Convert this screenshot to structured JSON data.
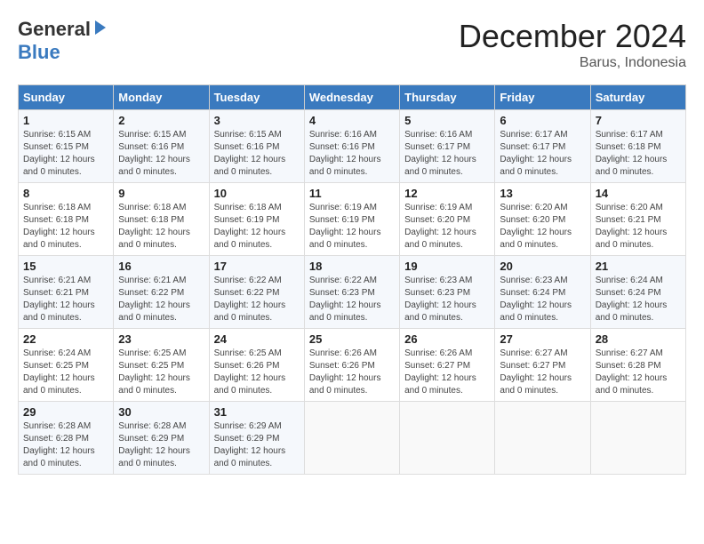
{
  "logo": {
    "general": "General",
    "blue": "Blue"
  },
  "title": {
    "month_year": "December 2024",
    "location": "Barus, Indonesia"
  },
  "days_of_week": [
    "Sunday",
    "Monday",
    "Tuesday",
    "Wednesday",
    "Thursday",
    "Friday",
    "Saturday"
  ],
  "weeks": [
    [
      {
        "day": "1",
        "sunrise": "6:15 AM",
        "sunset": "6:15 PM",
        "daylight": "12 hours and 0 minutes."
      },
      {
        "day": "2",
        "sunrise": "6:15 AM",
        "sunset": "6:16 PM",
        "daylight": "12 hours and 0 minutes."
      },
      {
        "day": "3",
        "sunrise": "6:15 AM",
        "sunset": "6:16 PM",
        "daylight": "12 hours and 0 minutes."
      },
      {
        "day": "4",
        "sunrise": "6:16 AM",
        "sunset": "6:16 PM",
        "daylight": "12 hours and 0 minutes."
      },
      {
        "day": "5",
        "sunrise": "6:16 AM",
        "sunset": "6:17 PM",
        "daylight": "12 hours and 0 minutes."
      },
      {
        "day": "6",
        "sunrise": "6:17 AM",
        "sunset": "6:17 PM",
        "daylight": "12 hours and 0 minutes."
      },
      {
        "day": "7",
        "sunrise": "6:17 AM",
        "sunset": "6:18 PM",
        "daylight": "12 hours and 0 minutes."
      }
    ],
    [
      {
        "day": "8",
        "sunrise": "6:18 AM",
        "sunset": "6:18 PM",
        "daylight": "12 hours and 0 minutes."
      },
      {
        "day": "9",
        "sunrise": "6:18 AM",
        "sunset": "6:18 PM",
        "daylight": "12 hours and 0 minutes."
      },
      {
        "day": "10",
        "sunrise": "6:18 AM",
        "sunset": "6:19 PM",
        "daylight": "12 hours and 0 minutes."
      },
      {
        "day": "11",
        "sunrise": "6:19 AM",
        "sunset": "6:19 PM",
        "daylight": "12 hours and 0 minutes."
      },
      {
        "day": "12",
        "sunrise": "6:19 AM",
        "sunset": "6:20 PM",
        "daylight": "12 hours and 0 minutes."
      },
      {
        "day": "13",
        "sunrise": "6:20 AM",
        "sunset": "6:20 PM",
        "daylight": "12 hours and 0 minutes."
      },
      {
        "day": "14",
        "sunrise": "6:20 AM",
        "sunset": "6:21 PM",
        "daylight": "12 hours and 0 minutes."
      }
    ],
    [
      {
        "day": "15",
        "sunrise": "6:21 AM",
        "sunset": "6:21 PM",
        "daylight": "12 hours and 0 minutes."
      },
      {
        "day": "16",
        "sunrise": "6:21 AM",
        "sunset": "6:22 PM",
        "daylight": "12 hours and 0 minutes."
      },
      {
        "day": "17",
        "sunrise": "6:22 AM",
        "sunset": "6:22 PM",
        "daylight": "12 hours and 0 minutes."
      },
      {
        "day": "18",
        "sunrise": "6:22 AM",
        "sunset": "6:23 PM",
        "daylight": "12 hours and 0 minutes."
      },
      {
        "day": "19",
        "sunrise": "6:23 AM",
        "sunset": "6:23 PM",
        "daylight": "12 hours and 0 minutes."
      },
      {
        "day": "20",
        "sunrise": "6:23 AM",
        "sunset": "6:24 PM",
        "daylight": "12 hours and 0 minutes."
      },
      {
        "day": "21",
        "sunrise": "6:24 AM",
        "sunset": "6:24 PM",
        "daylight": "12 hours and 0 minutes."
      }
    ],
    [
      {
        "day": "22",
        "sunrise": "6:24 AM",
        "sunset": "6:25 PM",
        "daylight": "12 hours and 0 minutes."
      },
      {
        "day": "23",
        "sunrise": "6:25 AM",
        "sunset": "6:25 PM",
        "daylight": "12 hours and 0 minutes."
      },
      {
        "day": "24",
        "sunrise": "6:25 AM",
        "sunset": "6:26 PM",
        "daylight": "12 hours and 0 minutes."
      },
      {
        "day": "25",
        "sunrise": "6:26 AM",
        "sunset": "6:26 PM",
        "daylight": "12 hours and 0 minutes."
      },
      {
        "day": "26",
        "sunrise": "6:26 AM",
        "sunset": "6:27 PM",
        "daylight": "12 hours and 0 minutes."
      },
      {
        "day": "27",
        "sunrise": "6:27 AM",
        "sunset": "6:27 PM",
        "daylight": "12 hours and 0 minutes."
      },
      {
        "day": "28",
        "sunrise": "6:27 AM",
        "sunset": "6:28 PM",
        "daylight": "12 hours and 0 minutes."
      }
    ],
    [
      {
        "day": "29",
        "sunrise": "6:28 AM",
        "sunset": "6:28 PM",
        "daylight": "12 hours and 0 minutes."
      },
      {
        "day": "30",
        "sunrise": "6:28 AM",
        "sunset": "6:29 PM",
        "daylight": "12 hours and 0 minutes."
      },
      {
        "day": "31",
        "sunrise": "6:29 AM",
        "sunset": "6:29 PM",
        "daylight": "12 hours and 0 minutes."
      },
      null,
      null,
      null,
      null
    ]
  ],
  "labels": {
    "sunrise": "Sunrise:",
    "sunset": "Sunset:",
    "daylight": "Daylight:"
  }
}
